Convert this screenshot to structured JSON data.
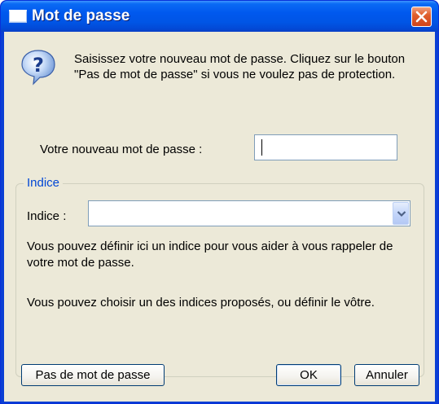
{
  "window": {
    "title": "Mot de passe"
  },
  "intro_text": "Saisissez votre nouveau mot de passe. Cliquez sur le bouton \"Pas de mot de passe\" si vous ne voulez pas de protection.",
  "password": {
    "label": "Votre nouveau mot de passe :",
    "value": ""
  },
  "hint_group": {
    "legend": "Indice",
    "label": "Indice  :",
    "selected_value": "",
    "description_1": "Vous pouvez définir ici un indice pour vous aider à vous rappeler de votre mot de passe.",
    "description_2": "Vous pouvez choisir un des indices proposés, ou définir le vôtre."
  },
  "buttons": {
    "no_password": "Pas de mot de passe",
    "ok": "OK",
    "cancel": "Annuler"
  },
  "colors": {
    "titlebar": "#0058ee",
    "client_bg": "#ece9d8",
    "group_legend": "#0046d5",
    "close_button": "#e0602e"
  },
  "icons": {
    "window": "window-icon",
    "close": "close-icon",
    "question": "question-icon",
    "dropdown": "chevron-down-icon"
  }
}
